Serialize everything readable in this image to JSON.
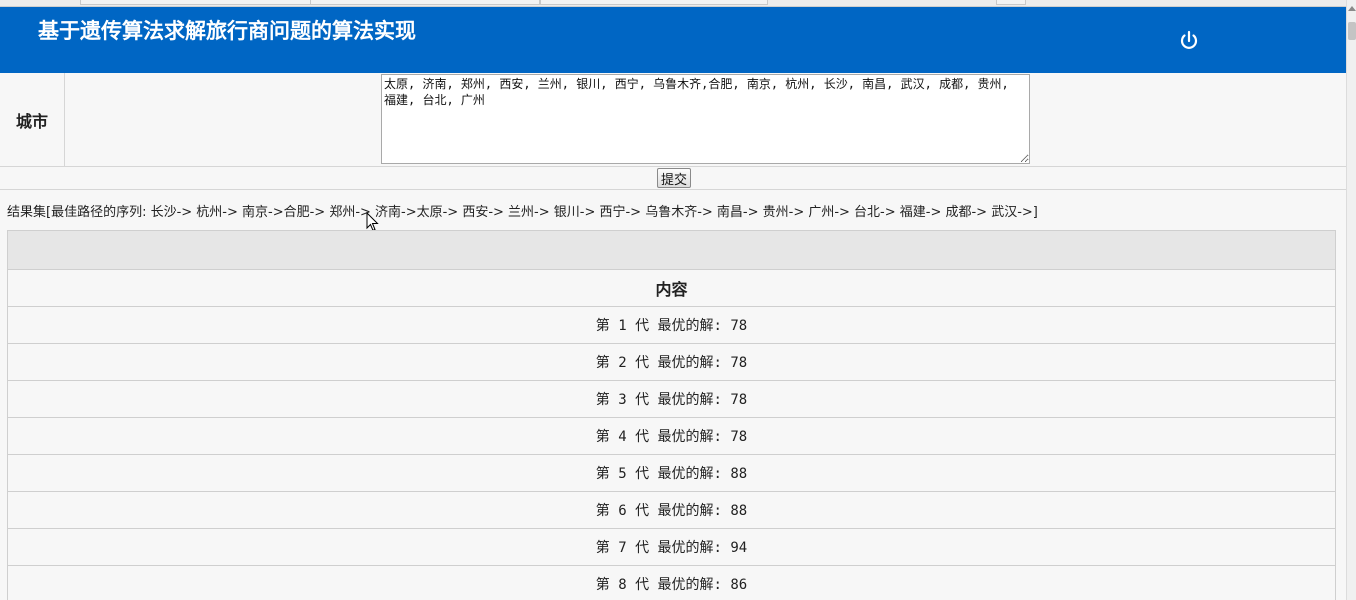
{
  "header": {
    "title": "基于遗传算法求解旅行商问题的算法实现",
    "bg_color": "#0066c4",
    "power_icon": "power-icon"
  },
  "form": {
    "city_label": "城市",
    "cities_value": "太原, 济南, 郑州, 西安, 兰州, 银川, 西宁, 乌鲁木齐,合肥, 南京, 杭州, 长沙, 南昌, 武汉, 成都, 贵州, 福建, 台北, 广州",
    "submit_label": "提交"
  },
  "result": {
    "text": "结果集[最佳路径的序列:  长沙-> 杭州-> 南京->合肥-> 郑州-> 济南->太原-> 西安-> 兰州-> 银川-> 西宁-> 乌鲁木齐-> 南昌-> 贵州-> 广州-> 台北-> 福建-> 成都-> 武汉->]"
  },
  "table": {
    "header": "内容",
    "rows": [
      "第 1 代 最优的解: 78",
      "第 2 代 最优的解: 78",
      "第 3 代 最优的解: 78",
      "第 4 代 最优的解: 78",
      "第 5 代 最优的解: 88",
      "第 6 代 最优的解: 88",
      "第 7 代 最优的解: 94",
      "第 8 代 最优的解: 86"
    ]
  }
}
